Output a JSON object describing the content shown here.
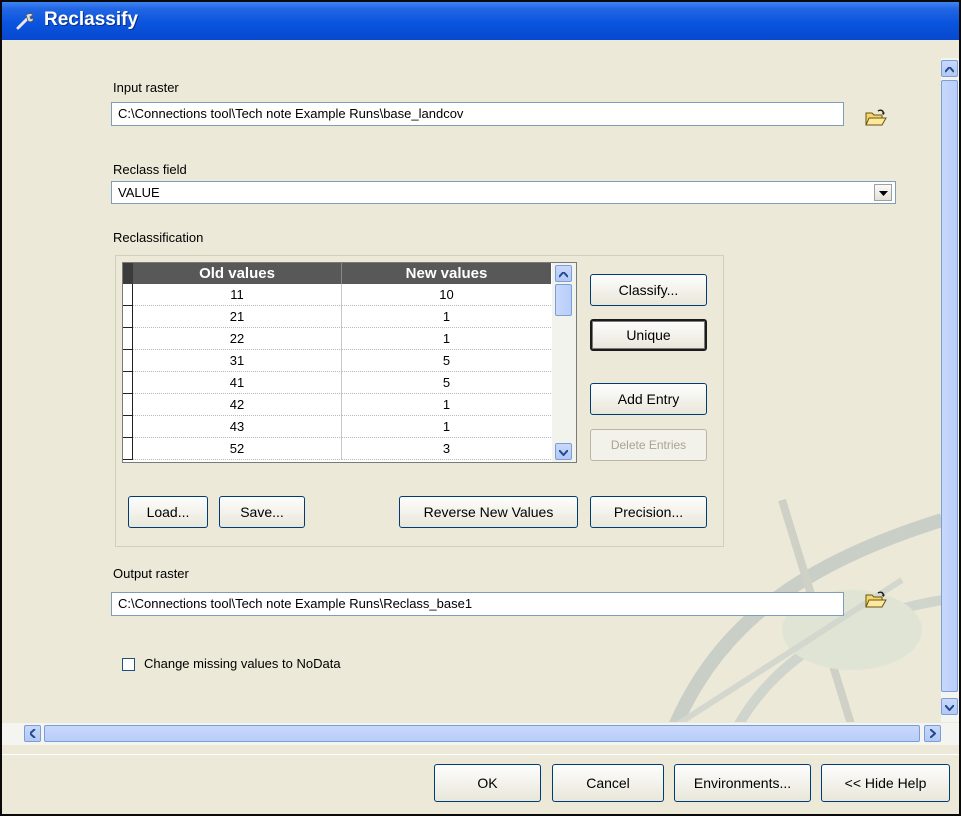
{
  "window": {
    "title": "Reclassify"
  },
  "input_raster": {
    "label": "Input raster",
    "value": "C:\\Connections tool\\Tech note Example Runs\\base_landcov"
  },
  "reclass_field": {
    "label": "Reclass field",
    "value": "VALUE"
  },
  "reclassification": {
    "label": "Reclassification",
    "columns": [
      "Old values",
      "New values"
    ],
    "rows": [
      {
        "old": "11",
        "new": "10"
      },
      {
        "old": "21",
        "new": "1"
      },
      {
        "old": "22",
        "new": "1"
      },
      {
        "old": "31",
        "new": "5"
      },
      {
        "old": "41",
        "new": "5"
      },
      {
        "old": "42",
        "new": "1"
      },
      {
        "old": "43",
        "new": "1"
      },
      {
        "old": "52",
        "new": "3"
      }
    ],
    "buttons": {
      "classify": "Classify...",
      "unique": "Unique",
      "add_entry": "Add Entry",
      "delete_entries": "Delete Entries",
      "load": "Load...",
      "save": "Save...",
      "reverse": "Reverse New Values",
      "precision": "Precision..."
    }
  },
  "output_raster": {
    "label": "Output raster",
    "value": "C:\\Connections tool\\Tech note Example Runs\\Reclass_base1"
  },
  "missing_values": {
    "label": "Change missing values to NoData",
    "checked": false
  },
  "footer": {
    "ok": "OK",
    "cancel": "Cancel",
    "environments": "Environments...",
    "hide_help": "<< Hide Help"
  },
  "icons": {
    "title": "wrench-icon",
    "browse": "open-folder-icon"
  }
}
